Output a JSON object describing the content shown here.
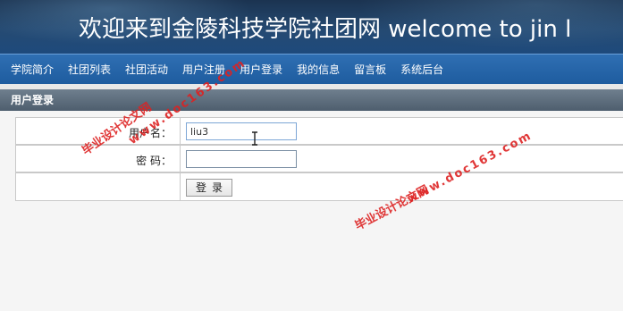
{
  "banner": {
    "title": "欢迎来到金陵科技学院社团网  welcome to jin l"
  },
  "nav": {
    "items": [
      {
        "label": "学院简介"
      },
      {
        "label": "社团列表"
      },
      {
        "label": "社团活动"
      },
      {
        "label": "用户注册"
      },
      {
        "label": "用户登录"
      },
      {
        "label": "我的信息"
      },
      {
        "label": "留言板"
      },
      {
        "label": "系统后台"
      }
    ]
  },
  "section": {
    "title": "用户登录"
  },
  "form": {
    "username_label": "用户名：",
    "username_value": "liu3",
    "password_label": "密  码：",
    "password_value": "",
    "login_label": "登录"
  },
  "watermarks": {
    "cn": "毕业设计论文网",
    "url": "www.doc163.com"
  }
}
